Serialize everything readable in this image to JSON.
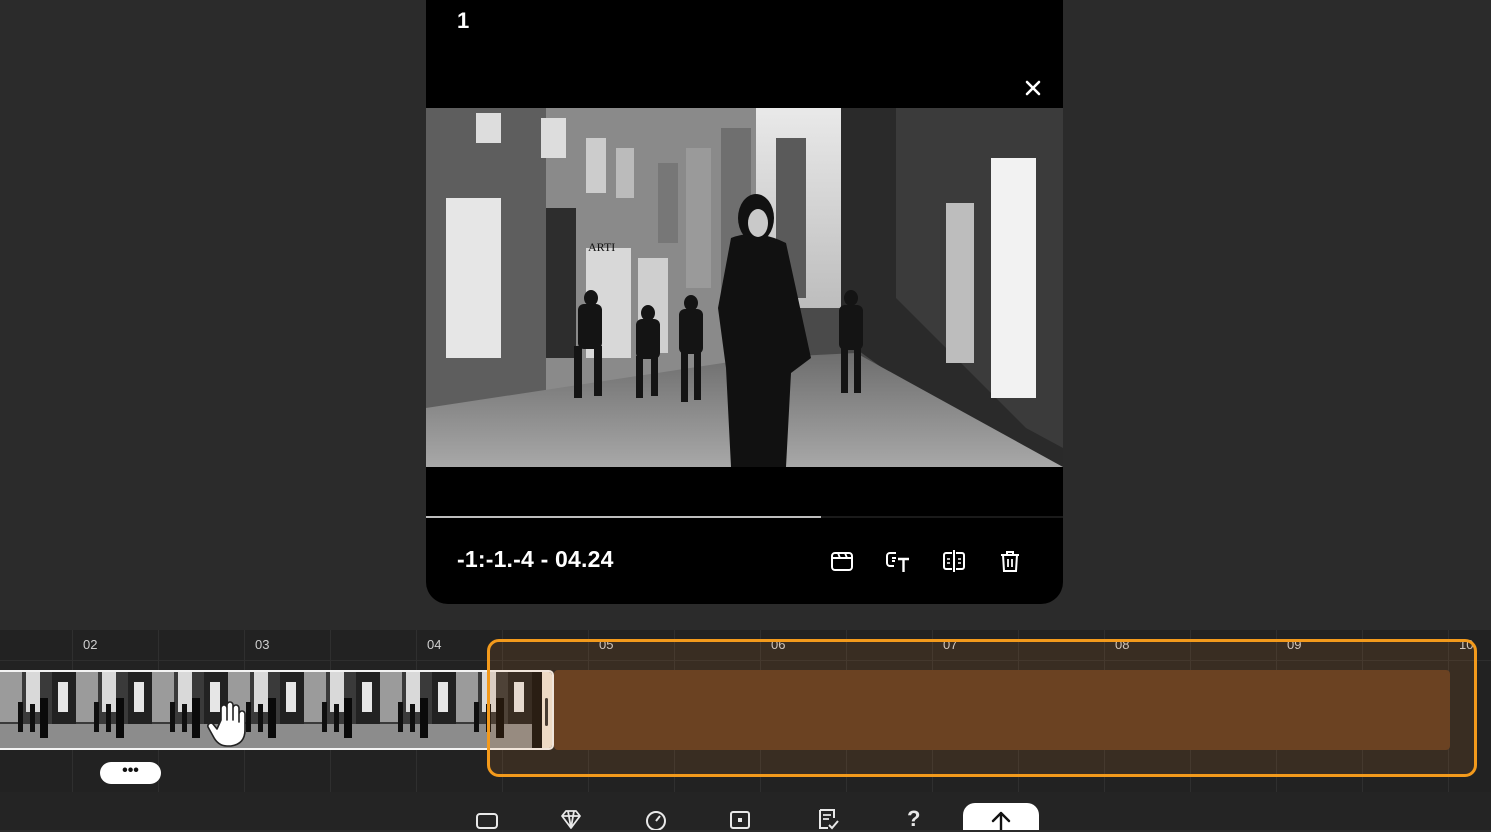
{
  "preview": {
    "clip_index": "1",
    "timecode": "-1:-1.-4 - 04.24",
    "progress": 0.62,
    "frame_sign_text": "ARTI"
  },
  "tools": {
    "preview_tools": [
      "clapperboard-icon",
      "caption-text-icon",
      "split-mirror-icon",
      "trash-icon"
    ],
    "close_icon": "close-icon"
  },
  "timeline": {
    "ruler_labels": [
      "02",
      "03",
      "04",
      "05",
      "06",
      "07",
      "08",
      "09",
      "10"
    ],
    "more_label": "•••"
  },
  "toolbar": {
    "icons": [
      "aspect-ratio-icon",
      "diamond-icon",
      "speed-icon",
      "canvas-icon",
      "script-icon"
    ],
    "help_label": "?",
    "export_icon": "upload-arrow-icon"
  },
  "colors": {
    "background": "#2b2b2b",
    "selection": "#f39a1c",
    "empty_track": "#5a3a22"
  }
}
